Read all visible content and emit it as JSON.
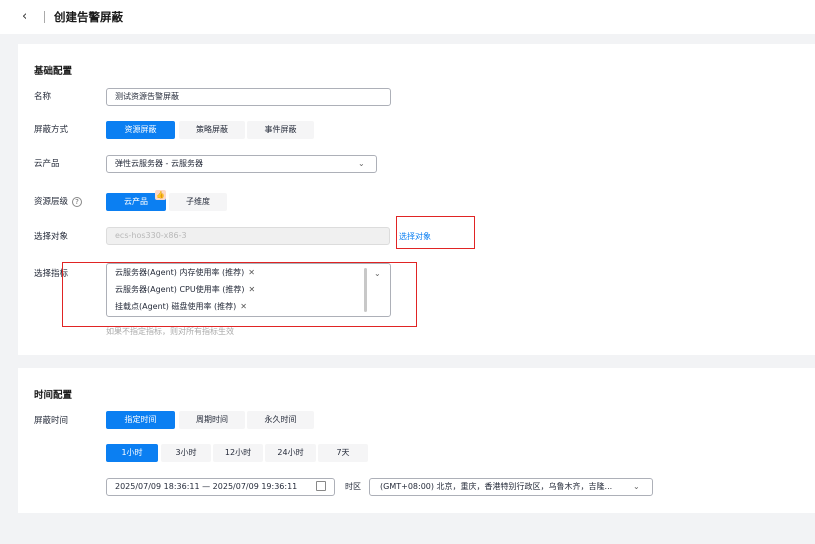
{
  "header": {
    "back_icon": "‹",
    "title": "创建告警屏蔽"
  },
  "basic": {
    "title": "基础配置",
    "name_label": "名称",
    "name_value": "测试资源告警屏蔽",
    "mode_label": "屏蔽方式",
    "modes": [
      "资源屏蔽",
      "策略屏蔽",
      "事件屏蔽"
    ],
    "product_label": "云产品",
    "product_value": "弹性云服务器 - 云服务器",
    "level_label": "资源层级",
    "levels": [
      "云产品",
      "子维度"
    ],
    "object_label": "选择对象",
    "object_value": "ecs-hos330-x86-3",
    "object_link": "选择对象",
    "metric_label": "选择指标",
    "metrics": [
      "云服务器(Agent) 内存使用率 (推荐)",
      "云服务器(Agent) CPU使用率 (推荐)",
      "挂载点(Agent) 磁盘使用率 (推荐)"
    ],
    "metric_hint": "如果不指定指标，则对所有指标生效"
  },
  "time": {
    "title": "时间配置",
    "shield_label": "屏蔽时间",
    "types": [
      "指定时间",
      "周期时间",
      "永久时间"
    ],
    "quick": [
      "1小时",
      "3小时",
      "12小时",
      "24小时",
      "7天"
    ],
    "range_value": "2025/07/09 18:36:11 — 2025/07/09 19:36:11",
    "tz_label": "时区",
    "tz_value": "(GMT+08:00) 北京，重庆，香港特别行政区，乌鲁木齐，吉隆..."
  },
  "colors": {
    "accent": "#0b7ff2",
    "highlight": "#e02424"
  }
}
